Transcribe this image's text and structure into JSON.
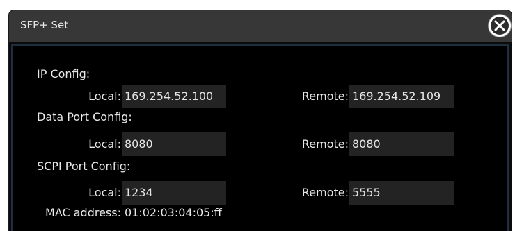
{
  "dialog": {
    "title": "SFP+ Set",
    "close_icon": "close-icon"
  },
  "ip_config": {
    "heading": "IP Config:",
    "local_label": "Local:",
    "local_value": "169.254.52.100",
    "remote_label": "Remote:",
    "remote_value": "169.254.52.109"
  },
  "data_port_config": {
    "heading": "Data Port Config:",
    "local_label": "Local:",
    "local_value": "8080",
    "remote_label": "Remote:",
    "remote_value": "8080"
  },
  "scpi_port_config": {
    "heading": "SCPI Port Config:",
    "local_label": "Local:",
    "local_value": "1234",
    "remote_label": "Remote:",
    "remote_value": "5555"
  },
  "mac": {
    "label": "MAC address:",
    "value": "01:02:03:04:05:ff"
  },
  "colors": {
    "title_bar": "#373737",
    "background": "#000000",
    "field": "#232323",
    "text": "#e8e8e8"
  }
}
